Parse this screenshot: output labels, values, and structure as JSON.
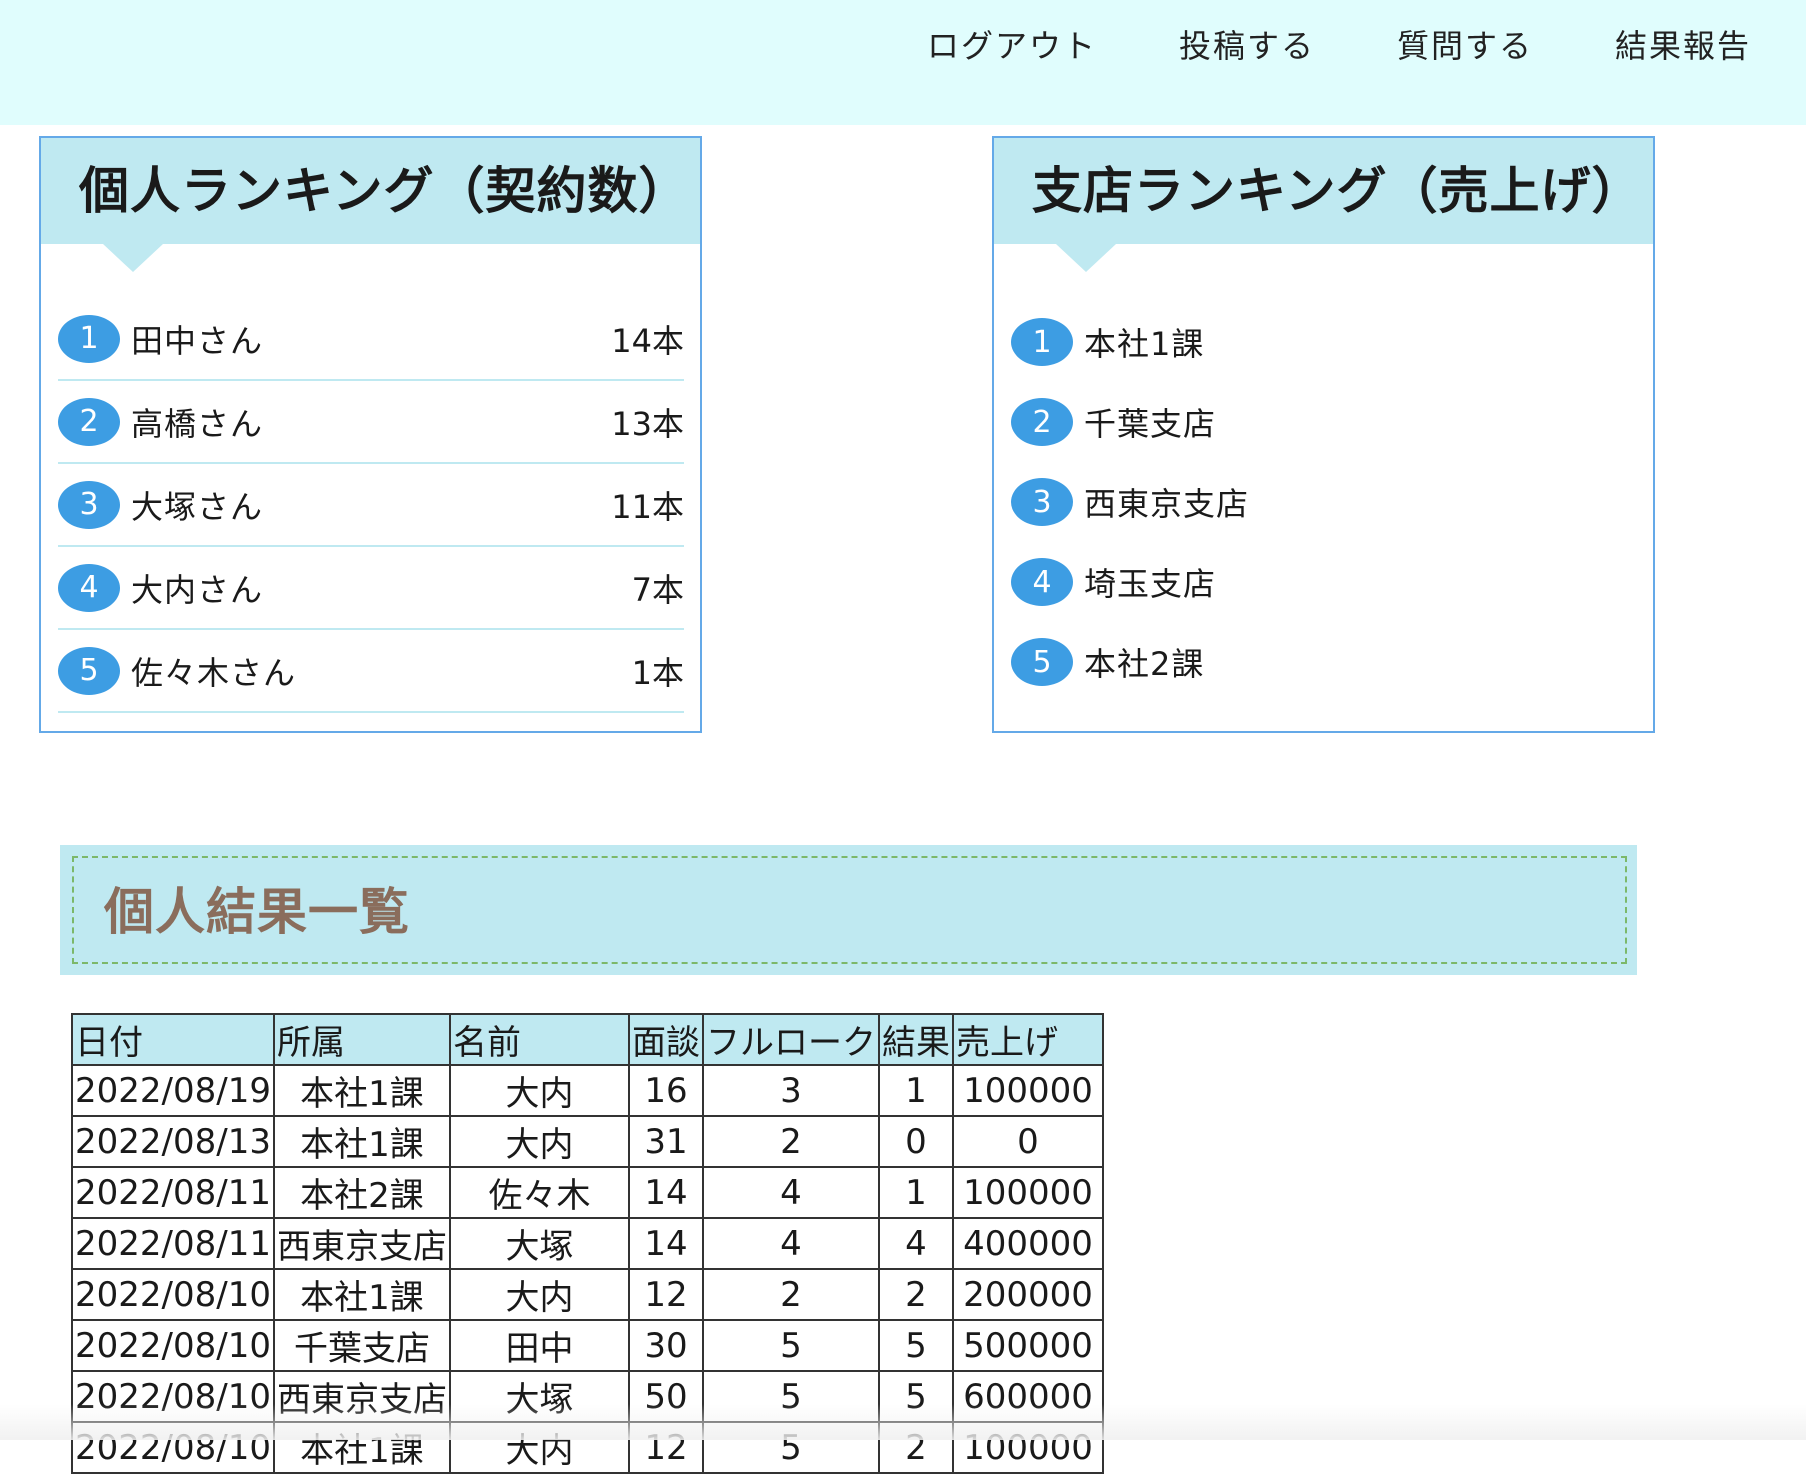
{
  "nav": {
    "logout": "ログアウト",
    "post": "投稿する",
    "question": "質問する",
    "report": "結果報告"
  },
  "personal_ranking": {
    "title": "個人ランキング（契約数）",
    "items": [
      {
        "rank": "1",
        "name": "田中さん",
        "value": "14本"
      },
      {
        "rank": "2",
        "name": "高橋さん",
        "value": "13本"
      },
      {
        "rank": "3",
        "name": "大塚さん",
        "value": "11本"
      },
      {
        "rank": "4",
        "name": "大内さん",
        "value": "7本"
      },
      {
        "rank": "5",
        "name": "佐々木さん",
        "value": "1本"
      }
    ]
  },
  "branch_ranking": {
    "title": "支店ランキング（売上げ）",
    "items": [
      {
        "rank": "1",
        "name": "本社1課"
      },
      {
        "rank": "2",
        "name": "千葉支店"
      },
      {
        "rank": "3",
        "name": "西東京支店"
      },
      {
        "rank": "4",
        "name": "埼玉支店"
      },
      {
        "rank": "5",
        "name": "本社2課"
      }
    ]
  },
  "results_section": {
    "title": "個人結果一覧",
    "columns": [
      "日付",
      "所属",
      "名前",
      "面談",
      "フルローク",
      "結果",
      "売上げ"
    ],
    "rows": [
      [
        "2022/08/19",
        "本社1課",
        "大内",
        "16",
        "3",
        "1",
        "100000"
      ],
      [
        "2022/08/13",
        "本社1課",
        "大内",
        "31",
        "2",
        "0",
        "0"
      ],
      [
        "2022/08/11",
        "本社2課",
        "佐々木",
        "14",
        "4",
        "1",
        "100000"
      ],
      [
        "2022/08/11",
        "西東京支店",
        "大塚",
        "14",
        "4",
        "4",
        "400000"
      ],
      [
        "2022/08/10",
        "本社1課",
        "大内",
        "12",
        "2",
        "2",
        "200000"
      ],
      [
        "2022/08/10",
        "千葉支店",
        "田中",
        "30",
        "5",
        "5",
        "500000"
      ],
      [
        "2022/08/10",
        "西東京支店",
        "大塚",
        "50",
        "5",
        "5",
        "600000"
      ],
      [
        "2022/08/10",
        "本社1課",
        "大内",
        "12",
        "5",
        "2",
        "100000"
      ]
    ]
  },
  "colors": {
    "header_bg": "#e0fdfd",
    "panel_head_bg": "#bfe9f1",
    "rank_badge": "#3d9de3",
    "panel_border": "#64a9e8",
    "section_title": "#8a6d5c"
  }
}
